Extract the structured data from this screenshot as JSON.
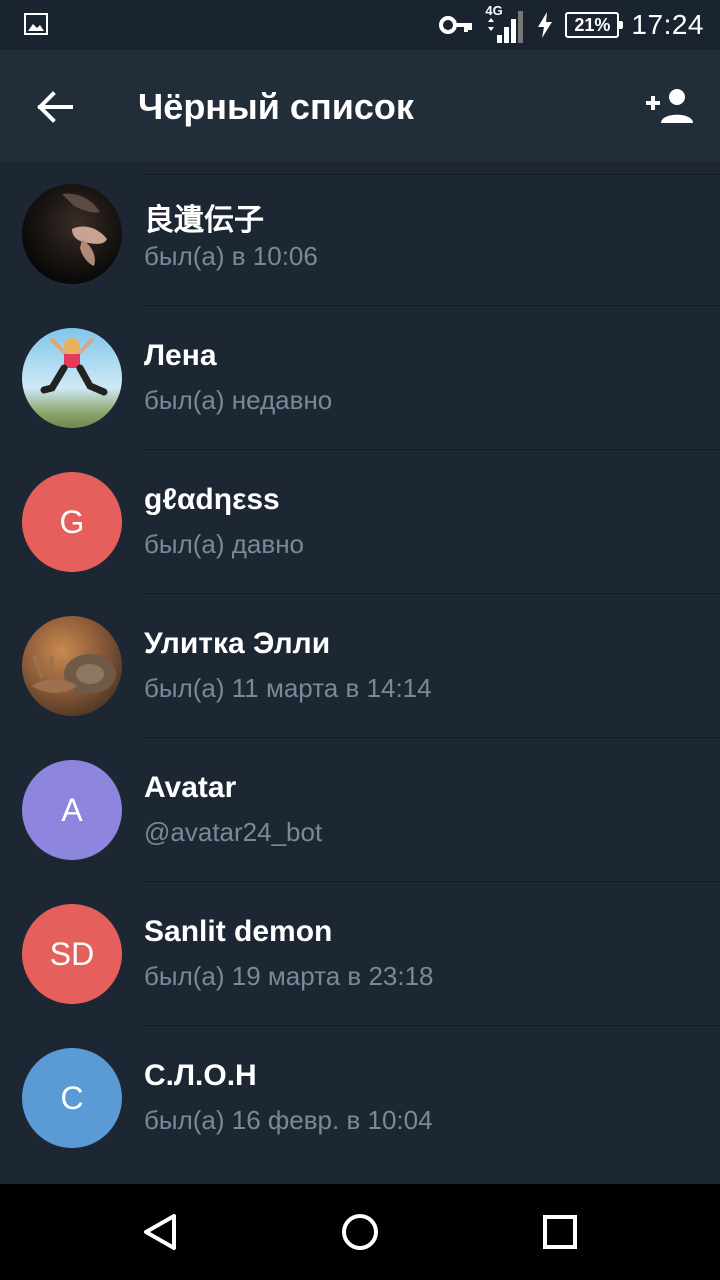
{
  "status_bar": {
    "network": "4G",
    "battery": "21%",
    "time": "17:24"
  },
  "app_bar": {
    "title": "Чёрный список"
  },
  "contacts": [
    {
      "name": "良遺伝子",
      "status": "был(а) в 10:06",
      "avatar_type": "photo",
      "avatar_initials": "",
      "avatar_color": "#0e0e0e"
    },
    {
      "name": "Лена",
      "status": "был(а) недавно",
      "avatar_type": "photo",
      "avatar_initials": "",
      "avatar_color": "#9fd3ee"
    },
    {
      "name": "gℓαdηεss",
      "status": "был(а) давно",
      "avatar_type": "initials",
      "avatar_initials": "G",
      "avatar_color": "#e5605d"
    },
    {
      "name": "Улитка Элли",
      "status": "был(а) 11 марта в 14:14",
      "avatar_type": "photo",
      "avatar_initials": "",
      "avatar_color": "#6b4a33"
    },
    {
      "name": "Avatar",
      "status": "@avatar24_bot",
      "avatar_type": "initials",
      "avatar_initials": "A",
      "avatar_color": "#8e85de"
    },
    {
      "name": "Sanlit demon",
      "status": "был(а) 19 марта в 23:18",
      "avatar_type": "initials",
      "avatar_initials": "SD",
      "avatar_color": "#e5605d"
    },
    {
      "name": "С.Л.О.Н",
      "status": "был(а) 16 февр. в 10:04",
      "avatar_type": "initials",
      "avatar_initials": "C",
      "avatar_color": "#5b9bd5"
    }
  ],
  "icons": {
    "back": "arrow-left-icon",
    "add_user": "person-add-icon",
    "nav_back": "triangle-back-icon",
    "nav_home": "circle-home-icon",
    "nav_recents": "square-recents-icon"
  }
}
